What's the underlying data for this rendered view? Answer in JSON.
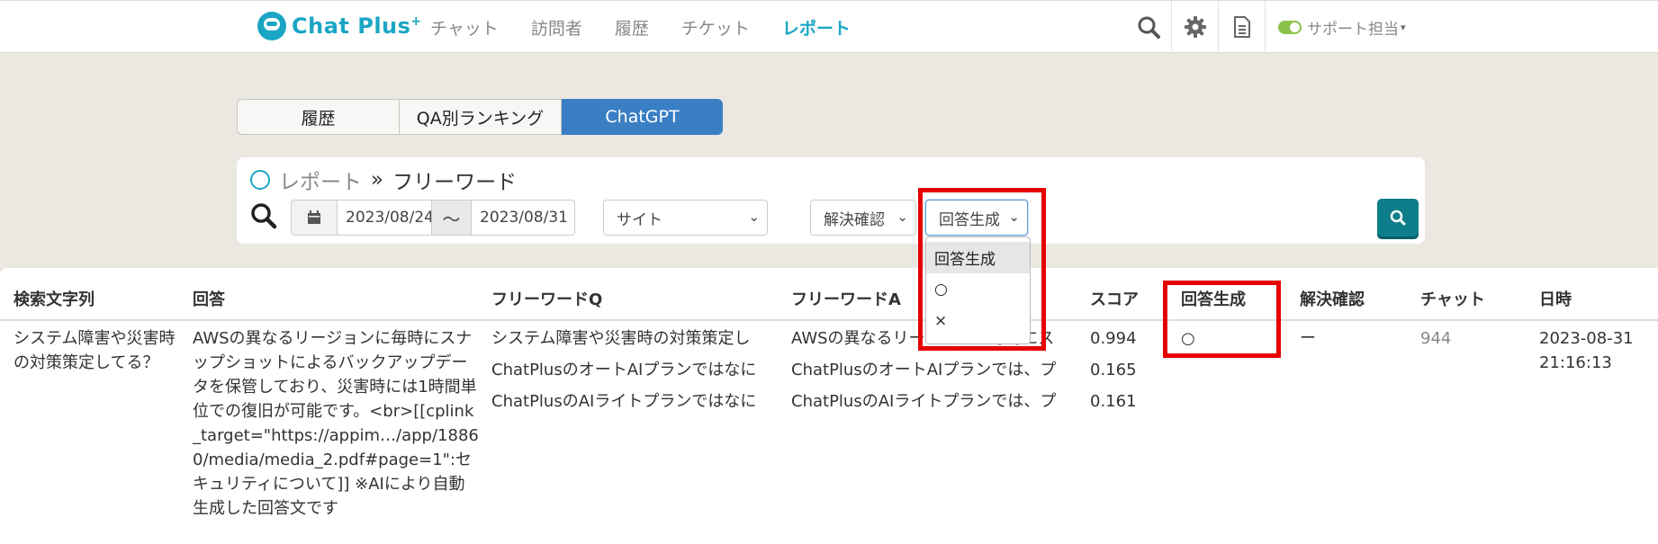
{
  "brand": {
    "name": "Chat Plus",
    "sup": "+"
  },
  "nav": [
    "チャット",
    "訪問者",
    "履歴",
    "チケット",
    "レポート"
  ],
  "header_icons": [
    "search-icon",
    "gear-icon",
    "document-icon"
  ],
  "user": {
    "label": "サポート担当",
    "status_color": "#8bc34a"
  },
  "tabs": [
    "履歴",
    "QA別ランキング",
    "ChatGPT"
  ],
  "breadcrumb": {
    "parent": "レポート",
    "sep": "»",
    "current": "フリーワード"
  },
  "filters": {
    "date_from": "2023/08/24",
    "tilde": "～",
    "date_to": "2023/08/31",
    "site": "サイト",
    "resolve": "解決確認",
    "generate": "回答生成"
  },
  "dropdown": [
    "回答生成",
    "○",
    "×"
  ],
  "table": {
    "headers": [
      "検索文字列",
      "回答",
      "フリーワードQ",
      "フリーワードA",
      "スコア",
      "回答生成",
      "解決確認",
      "チャット",
      "日時"
    ],
    "row": {
      "query": "システム障害や災害時の対策策定してる？",
      "answer": "AWSの異なるリージョンに毎時にスナップショットによるバックアップデータを保管しており、災害時には1時間単位での復旧が可能です。<br>[[cplink_target=\"https://appim…/app/18860/media/media_2.pdf#page=1\":セキュリティについて]] ※AIにより自動生成した回答文です",
      "freeq": [
        "システム障害や災害時の対策策定し",
        "ChatPlusのオートAIプランではなに",
        "ChatPlusのAIライトプランではなに"
      ],
      "freea": [
        "AWSの異なるリージョンに毎時にス",
        "ChatPlusのオートAIプランでは、プ",
        "ChatPlusのAIライトプランでは、プ"
      ],
      "scores": [
        "0.994",
        "0.165",
        "0.161"
      ],
      "generate": "○",
      "resolve": "ー",
      "chat": "944",
      "date": "2023-08-31",
      "time": "21:16:13"
    }
  },
  "colors": {
    "accent": "#1aa6c4",
    "tab_active": "#3a7fc4",
    "search_btn": "#0e7f8a",
    "highlight": "#e60000"
  }
}
